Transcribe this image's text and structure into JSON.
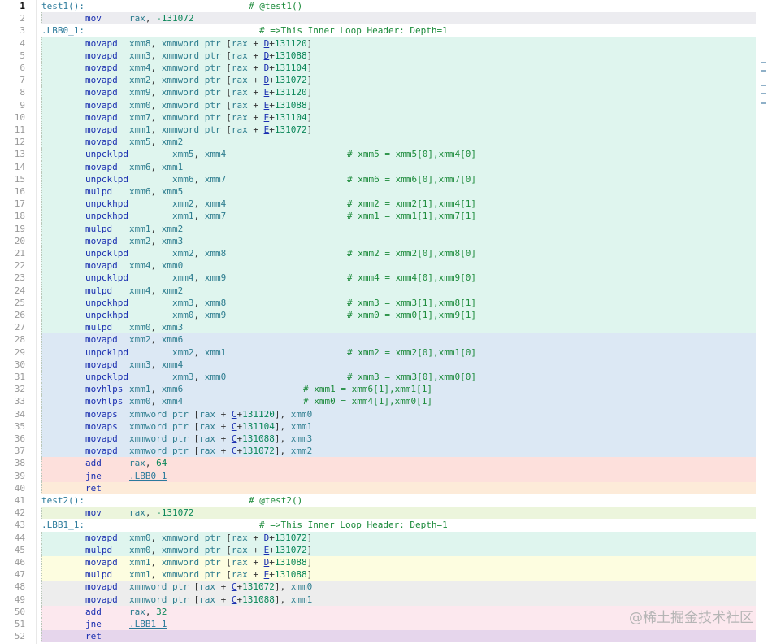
{
  "watermark": "@稀土掘金技术社区",
  "colors": {
    "mint": "#dff5ee",
    "blue": "#dce8f4",
    "red": "#fde0dc",
    "orange": "#fdebd9",
    "gray": "#ededed",
    "lime": "#ecf5dc",
    "yellow": "#fdfde0",
    "pink": "#fce8ee",
    "purple": "#e6d6ec",
    "white": "#ffffff",
    "active_line": "#ececf0"
  },
  "lines": [
    {
      "n": 1,
      "bg": "white",
      "indent": 0,
      "label": "test1():",
      "comment": "# @test1()",
      "ccol": 255,
      "active": true
    },
    {
      "n": 2,
      "bg": "active_line",
      "indent": 1,
      "op": "mov",
      "args": "rax, -131072"
    },
    {
      "n": 3,
      "bg": "white",
      "indent": 0,
      "label": ".LBB0_1:",
      "comment": "# =>This Inner Loop Header: Depth=1",
      "ccol": 268
    },
    {
      "n": 4,
      "bg": "mint",
      "indent": 1,
      "op": "movapd",
      "args": "xmm8, xmmword ptr [rax + D+131120]"
    },
    {
      "n": 5,
      "bg": "mint",
      "indent": 1,
      "op": "movapd",
      "args": "xmm3, xmmword ptr [rax + D+131088]"
    },
    {
      "n": 6,
      "bg": "mint",
      "indent": 1,
      "op": "movapd",
      "args": "xmm4, xmmword ptr [rax + D+131104]"
    },
    {
      "n": 7,
      "bg": "mint",
      "indent": 1,
      "op": "movapd",
      "args": "xmm2, xmmword ptr [rax + D+131072]"
    },
    {
      "n": 8,
      "bg": "mint",
      "indent": 1,
      "op": "movapd",
      "args": "xmm9, xmmword ptr [rax + E+131120]"
    },
    {
      "n": 9,
      "bg": "mint",
      "indent": 1,
      "op": "movapd",
      "args": "xmm0, xmmword ptr [rax + E+131088]"
    },
    {
      "n": 10,
      "bg": "mint",
      "indent": 1,
      "op": "movapd",
      "args": "xmm7, xmmword ptr [rax + E+131104]"
    },
    {
      "n": 11,
      "bg": "mint",
      "indent": 1,
      "op": "movapd",
      "args": "xmm1, xmmword ptr [rax + E+131072]"
    },
    {
      "n": 12,
      "bg": "mint",
      "indent": 1,
      "op": "movapd",
      "args": "xmm5, xmm2"
    },
    {
      "n": 13,
      "bg": "mint",
      "indent": 1,
      "op": "unpcklpd",
      "args": "xmm5, xmm4",
      "wide": true,
      "comment": "# xmm5 = xmm5[0],xmm4[0]",
      "ccol": 376
    },
    {
      "n": 14,
      "bg": "mint",
      "indent": 1,
      "op": "movapd",
      "args": "xmm6, xmm1"
    },
    {
      "n": 15,
      "bg": "mint",
      "indent": 1,
      "op": "unpcklpd",
      "args": "xmm6, xmm7",
      "wide": true,
      "comment": "# xmm6 = xmm6[0],xmm7[0]",
      "ccol": 376
    },
    {
      "n": 16,
      "bg": "mint",
      "indent": 1,
      "op": "mulpd",
      "args": "xmm6, xmm5"
    },
    {
      "n": 17,
      "bg": "mint",
      "indent": 1,
      "op": "unpckhpd",
      "args": "xmm2, xmm4",
      "wide": true,
      "comment": "# xmm2 = xmm2[1],xmm4[1]",
      "ccol": 376
    },
    {
      "n": 18,
      "bg": "mint",
      "indent": 1,
      "op": "unpckhpd",
      "args": "xmm1, xmm7",
      "wide": true,
      "comment": "# xmm1 = xmm1[1],xmm7[1]",
      "ccol": 376
    },
    {
      "n": 19,
      "bg": "mint",
      "indent": 1,
      "op": "mulpd",
      "args": "xmm1, xmm2"
    },
    {
      "n": 20,
      "bg": "mint",
      "indent": 1,
      "op": "movapd",
      "args": "xmm2, xmm3"
    },
    {
      "n": 21,
      "bg": "mint",
      "indent": 1,
      "op": "unpcklpd",
      "args": "xmm2, xmm8",
      "wide": true,
      "comment": "# xmm2 = xmm2[0],xmm8[0]",
      "ccol": 376
    },
    {
      "n": 22,
      "bg": "mint",
      "indent": 1,
      "op": "movapd",
      "args": "xmm4, xmm0"
    },
    {
      "n": 23,
      "bg": "mint",
      "indent": 1,
      "op": "unpcklpd",
      "args": "xmm4, xmm9",
      "wide": true,
      "comment": "# xmm4 = xmm4[0],xmm9[0]",
      "ccol": 376
    },
    {
      "n": 24,
      "bg": "mint",
      "indent": 1,
      "op": "mulpd",
      "args": "xmm4, xmm2"
    },
    {
      "n": 25,
      "bg": "mint",
      "indent": 1,
      "op": "unpckhpd",
      "args": "xmm3, xmm8",
      "wide": true,
      "comment": "# xmm3 = xmm3[1],xmm8[1]",
      "ccol": 376
    },
    {
      "n": 26,
      "bg": "mint",
      "indent": 1,
      "op": "unpckhpd",
      "args": "xmm0, xmm9",
      "wide": true,
      "comment": "# xmm0 = xmm0[1],xmm9[1]",
      "ccol": 376
    },
    {
      "n": 27,
      "bg": "mint",
      "indent": 1,
      "op": "mulpd",
      "args": "xmm0, xmm3"
    },
    {
      "n": 28,
      "bg": "blue",
      "indent": 1,
      "op": "movapd",
      "args": "xmm2, xmm6"
    },
    {
      "n": 29,
      "bg": "blue",
      "indent": 1,
      "op": "unpcklpd",
      "args": "xmm2, xmm1",
      "wide": true,
      "comment": "# xmm2 = xmm2[0],xmm1[0]",
      "ccol": 376
    },
    {
      "n": 30,
      "bg": "blue",
      "indent": 1,
      "op": "movapd",
      "args": "xmm3, xmm4"
    },
    {
      "n": 31,
      "bg": "blue",
      "indent": 1,
      "op": "unpcklpd",
      "args": "xmm3, xmm0",
      "wide": true,
      "comment": "# xmm3 = xmm3[0],xmm0[0]",
      "ccol": 376
    },
    {
      "n": 32,
      "bg": "blue",
      "indent": 1,
      "op": "movhlps",
      "args": "xmm1, xmm6",
      "comment": "# xmm1 = xmm6[1],xmm1[1]",
      "ccol": 322
    },
    {
      "n": 33,
      "bg": "blue",
      "indent": 1,
      "op": "movhlps",
      "args": "xmm0, xmm4",
      "comment": "# xmm0 = xmm4[1],xmm0[1]",
      "ccol": 322
    },
    {
      "n": 34,
      "bg": "blue",
      "indent": 1,
      "op": "movaps",
      "args": "xmmword ptr [rax + C+131120], xmm0"
    },
    {
      "n": 35,
      "bg": "blue",
      "indent": 1,
      "op": "movaps",
      "args": "xmmword ptr [rax + C+131104], xmm1"
    },
    {
      "n": 36,
      "bg": "blue",
      "indent": 1,
      "op": "movapd",
      "args": "xmmword ptr [rax + C+131088], xmm3"
    },
    {
      "n": 37,
      "bg": "blue",
      "indent": 1,
      "op": "movapd",
      "args": "xmmword ptr [rax + C+131072], xmm2"
    },
    {
      "n": 38,
      "bg": "red",
      "indent": 1,
      "op": "add",
      "args": "rax, 64"
    },
    {
      "n": 39,
      "bg": "red",
      "indent": 1,
      "op": "jne",
      "args": ".LBB0_1",
      "link": true
    },
    {
      "n": 40,
      "bg": "orange",
      "indent": 1,
      "op": "ret",
      "args": ""
    },
    {
      "n": 41,
      "bg": "white",
      "indent": 0,
      "label": "test2():",
      "comment": "# @test2()",
      "ccol": 255
    },
    {
      "n": 42,
      "bg": "lime",
      "indent": 1,
      "op": "mov",
      "args": "rax, -131072"
    },
    {
      "n": 43,
      "bg": "white",
      "indent": 0,
      "label": ".LBB1_1:",
      "comment": "# =>This Inner Loop Header: Depth=1",
      "ccol": 268
    },
    {
      "n": 44,
      "bg": "mint",
      "indent": 1,
      "op": "movapd",
      "args": "xmm0, xmmword ptr [rax + D+131072]"
    },
    {
      "n": 45,
      "bg": "mint",
      "indent": 1,
      "op": "mulpd",
      "args": "xmm0, xmmword ptr [rax + E+131072]"
    },
    {
      "n": 46,
      "bg": "yellow",
      "indent": 1,
      "op": "movapd",
      "args": "xmm1, xmmword ptr [rax + D+131088]"
    },
    {
      "n": 47,
      "bg": "yellow",
      "indent": 1,
      "op": "mulpd",
      "args": "xmm1, xmmword ptr [rax + E+131088]"
    },
    {
      "n": 48,
      "bg": "gray",
      "indent": 1,
      "op": "movapd",
      "args": "xmmword ptr [rax + C+131072], xmm0"
    },
    {
      "n": 49,
      "bg": "gray",
      "indent": 1,
      "op": "movapd",
      "args": "xmmword ptr [rax + C+131088], xmm1"
    },
    {
      "n": 50,
      "bg": "pink",
      "indent": 1,
      "op": "add",
      "args": "rax, 32"
    },
    {
      "n": 51,
      "bg": "pink",
      "indent": 1,
      "op": "jne",
      "args": ".LBB1_1",
      "link": true
    },
    {
      "n": 52,
      "bg": "purple",
      "indent": 1,
      "op": "ret",
      "args": ""
    }
  ]
}
